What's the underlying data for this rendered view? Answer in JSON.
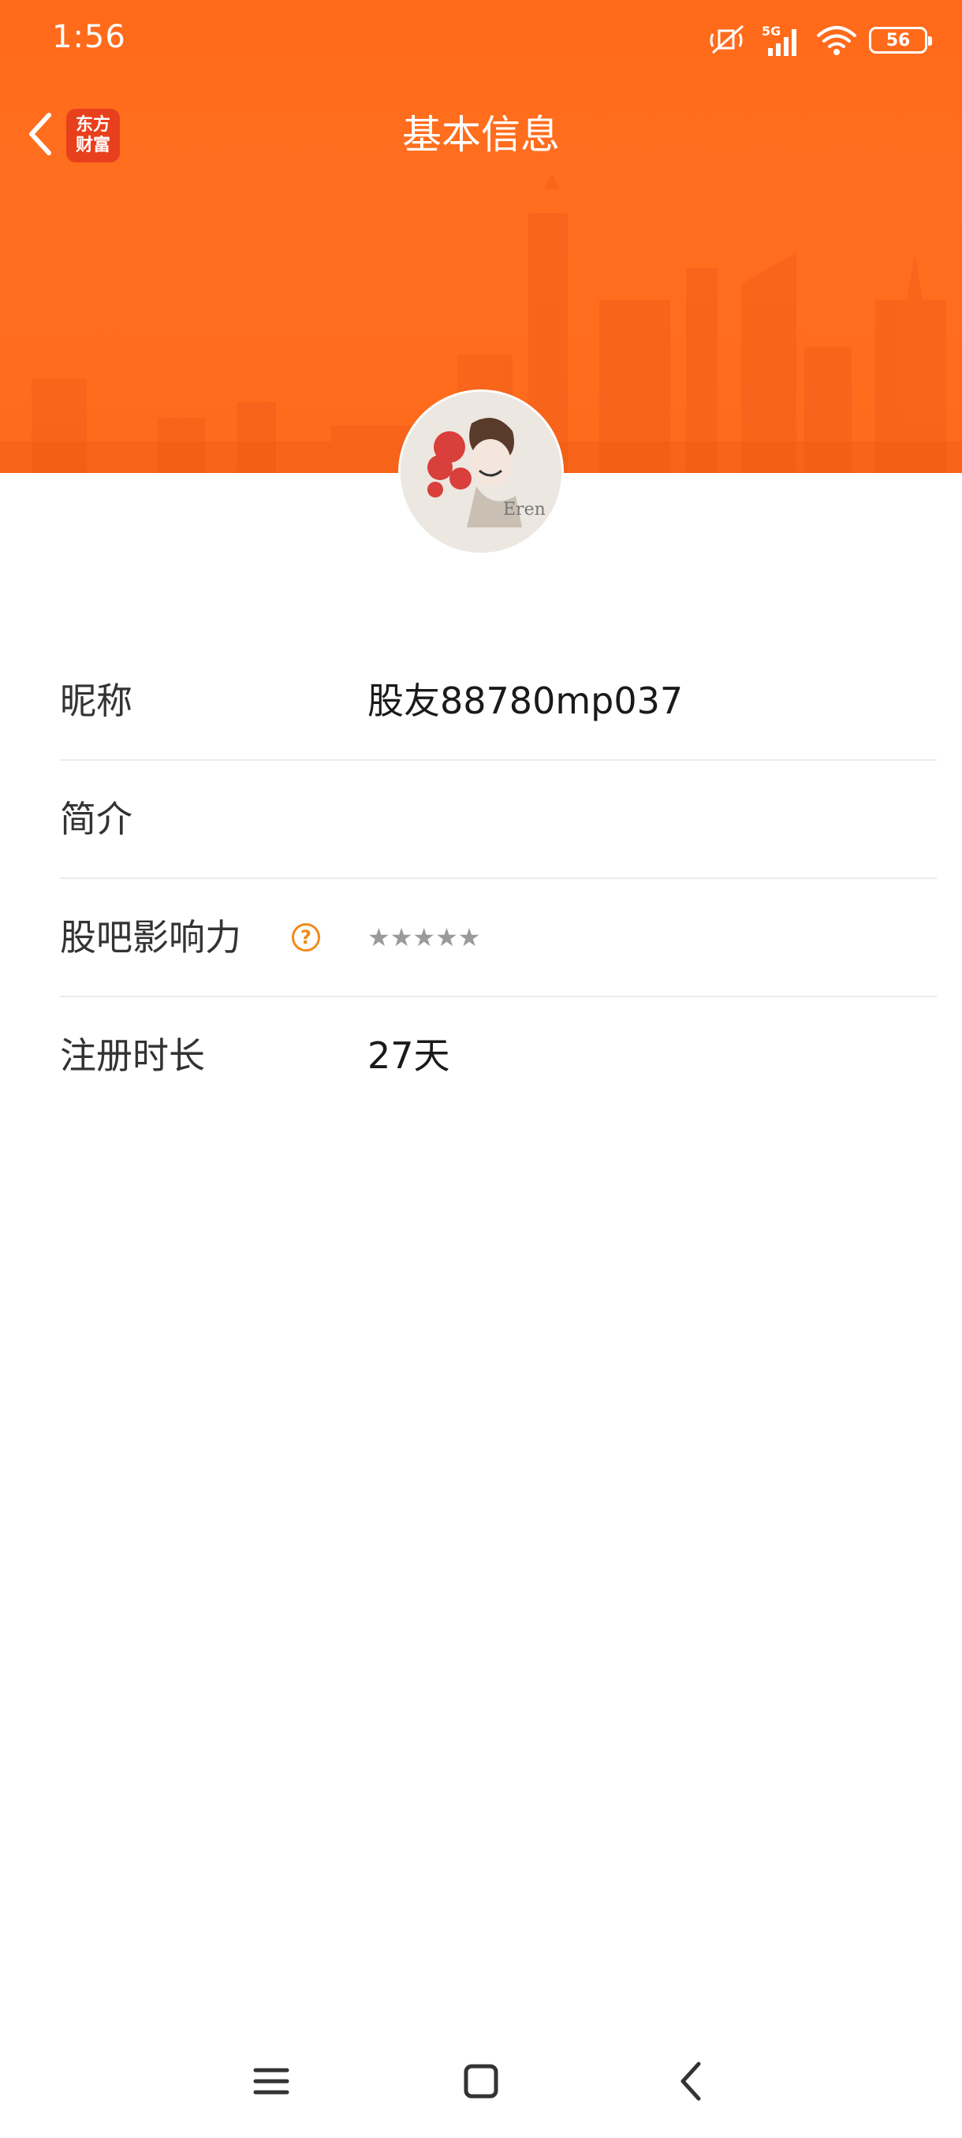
{
  "status_bar": {
    "time": "1:56",
    "network": "5G",
    "battery": "56"
  },
  "nav": {
    "title": "基本信息",
    "brand_line1": "东方",
    "brand_line2": "财富"
  },
  "info": {
    "nickname": {
      "label": "昵称",
      "value": "股友88780mp037"
    },
    "bio": {
      "label": "简介",
      "value": ""
    },
    "influence": {
      "label": "股吧影响力",
      "help": "?",
      "stars": "★★★★★",
      "rating": 0,
      "max_rating": 5
    },
    "registration": {
      "label": "注册时长",
      "value": "27天"
    }
  },
  "avatar": {
    "text": "Eren"
  },
  "colors": {
    "header": "#ff6a1a",
    "accent": "#f08a1c",
    "brand_logo": "#e8401c"
  },
  "icons": [
    "back-arrow-icon",
    "mute-icon",
    "signal-icon",
    "wifi-icon",
    "battery-icon",
    "help-icon",
    "menu-icon",
    "home-icon",
    "back-icon"
  ]
}
